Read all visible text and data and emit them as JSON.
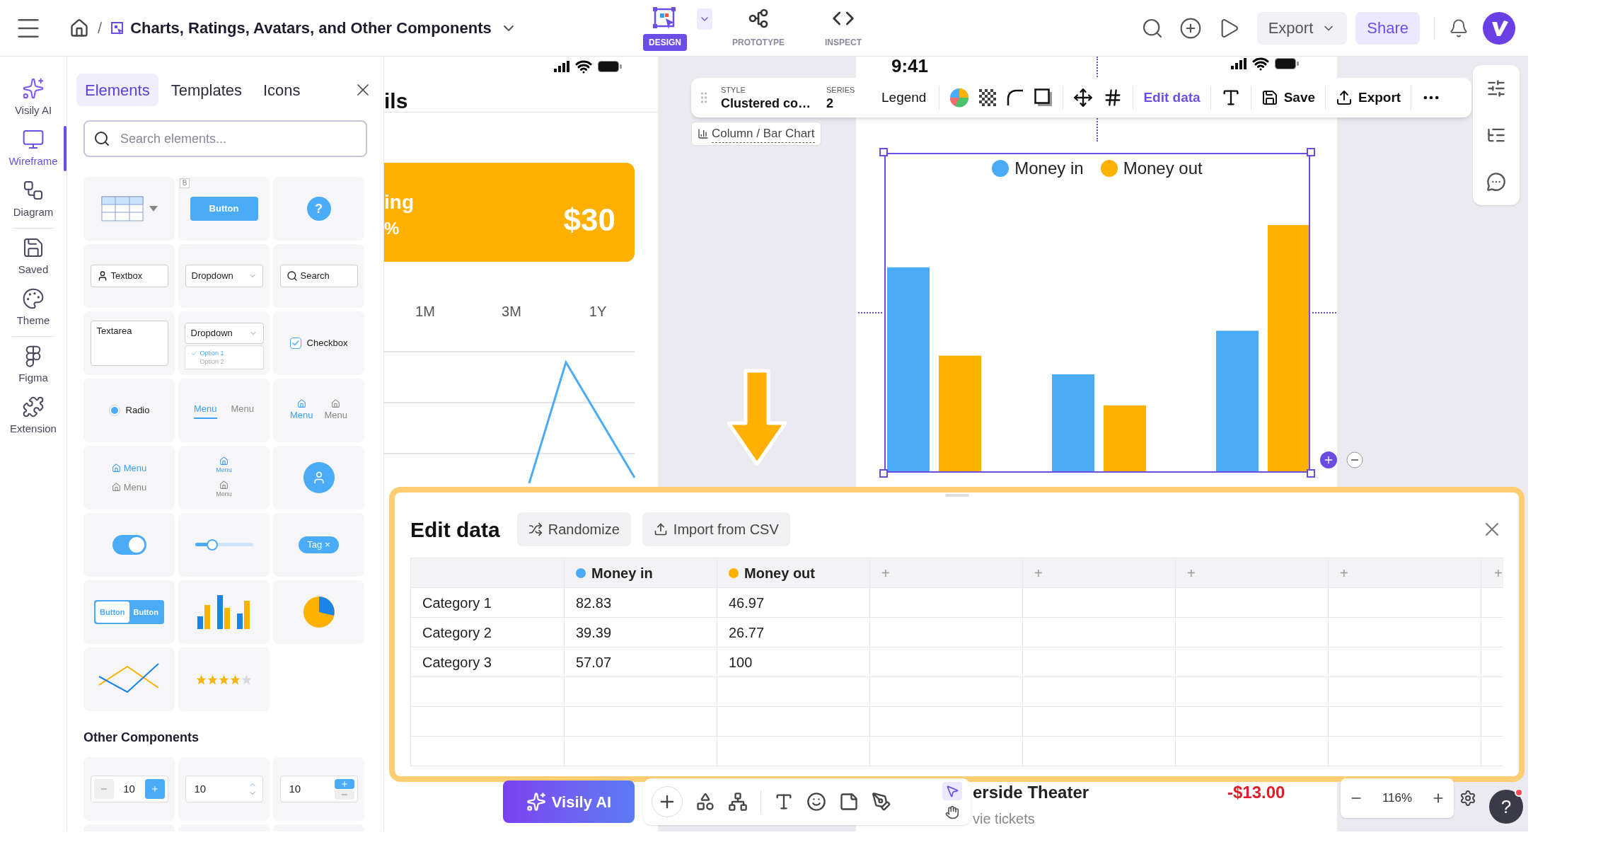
{
  "top_bar": {
    "separator": "/",
    "title": "Charts, Ratings, Avatars, and Other Components",
    "modes": [
      {
        "label": "DESIGN",
        "selected": true
      },
      {
        "label": "PROTOTYPE",
        "selected": false
      },
      {
        "label": "INSPECT",
        "selected": false
      }
    ],
    "export": "Export",
    "share": "Share"
  },
  "rail": [
    {
      "label": "Visily AI",
      "selected": false
    },
    {
      "label": "Wireframe",
      "selected": true
    },
    {
      "label": "Diagram",
      "selected": false
    },
    {
      "label": "Saved",
      "selected": false
    },
    {
      "label": "Theme",
      "selected": false
    },
    {
      "label": "Figma",
      "selected": false
    },
    {
      "label": "Extension",
      "selected": false
    }
  ],
  "panel": {
    "tabs": [
      {
        "label": "Elements",
        "selected": true
      },
      {
        "label": "Templates",
        "selected": false
      },
      {
        "label": "Icons",
        "selected": false
      }
    ],
    "search": {
      "placeholder": "Search elements..."
    },
    "tiles": [
      {
        "kind": "table"
      },
      {
        "kind": "button",
        "label": "Button",
        "badge": "B"
      },
      {
        "kind": "help",
        "label": "?"
      },
      {
        "kind": "textbox",
        "label": "Textbox"
      },
      {
        "kind": "dropdown",
        "label": "Dropdown"
      },
      {
        "kind": "search",
        "label": "Search"
      },
      {
        "kind": "textarea",
        "label": "Textarea"
      },
      {
        "kind": "dropdown_open",
        "label": "Dropdown",
        "options": [
          {
            "label": "Option 1",
            "selected": true
          },
          {
            "label": "Option 2",
            "selected": false
          }
        ]
      },
      {
        "kind": "checkbox",
        "label": "Checkbox",
        "checked": true
      },
      {
        "kind": "radio",
        "label": "Radio",
        "selected": true
      },
      {
        "kind": "menu_tabs",
        "items": [
          {
            "label": "Menu",
            "selected": true
          },
          {
            "label": "Menu",
            "selected": false
          }
        ]
      },
      {
        "kind": "menu_icons",
        "items": [
          {
            "label": "Menu",
            "selected": true
          },
          {
            "label": "Menu",
            "selected": false
          }
        ]
      },
      {
        "kind": "menu_list",
        "items": [
          {
            "label": "Menu",
            "selected": true
          },
          {
            "label": "Menu",
            "selected": false
          }
        ]
      },
      {
        "kind": "menu_stack",
        "items": [
          {
            "label": "Menu",
            "selected": true
          },
          {
            "label": "Menu",
            "selected": false
          }
        ]
      },
      {
        "kind": "avatar"
      },
      {
        "kind": "toggle",
        "on": true
      },
      {
        "kind": "slider",
        "level": 0.3
      },
      {
        "kind": "tag",
        "label": "Tag",
        "remove": "×"
      },
      {
        "kind": "segmented",
        "items": [
          {
            "label": "Button",
            "selected": true
          },
          {
            "label": "Button",
            "selected": false
          }
        ]
      },
      {
        "kind": "bars"
      },
      {
        "kind": "pie"
      },
      {
        "kind": "line"
      },
      {
        "kind": "stars",
        "stars": 4
      }
    ],
    "section_title": "Other Components",
    "other_tiles": [
      {
        "kind": "stepper",
        "value": "10"
      },
      {
        "kind": "spinner",
        "value": "10"
      },
      {
        "kind": "stacked_stepper",
        "value": "10"
      },
      {
        "kind": "empty"
      },
      {
        "kind": "empty"
      },
      {
        "kind": "empty"
      }
    ]
  },
  "left_frame": {
    "title": "ils",
    "card": {
      "line1": "ing",
      "line2": "%",
      "price": "$30"
    },
    "ranges": [
      "1M",
      "3M",
      "1Y"
    ]
  },
  "right_frame": {
    "time": "9:41",
    "legend": [
      {
        "label": "Money in",
        "color": "#4aabf9"
      },
      {
        "label": "Money out",
        "color": "#fdb100"
      }
    ],
    "footer": {
      "title": "erside Theater",
      "amount": "-$13.00",
      "subtitle": "vie tickets"
    }
  },
  "chart_toolbar": {
    "style_caption": "STYLE",
    "style": "Clustered co…",
    "series_caption": "SERIES",
    "series": "2",
    "legend": "Legend",
    "edit": "Edit data",
    "save": "Save",
    "export": "Export",
    "chart_type": "Column / Bar Chart"
  },
  "edit_data": {
    "title": "Edit data",
    "randomize": "Randomize",
    "import": "Import from CSV",
    "columns": [
      {
        "label": "Money in",
        "color": "#4aabf9"
      },
      {
        "label": "Money out",
        "color": "#fdb100"
      }
    ],
    "add_columns": [
      "+",
      "+",
      "+",
      "+",
      "+"
    ],
    "rows": [
      {
        "label": "Category 1",
        "values": [
          "82.83",
          "46.97"
        ]
      },
      {
        "label": "Category 2",
        "values": [
          "39.39",
          "26.77"
        ]
      },
      {
        "label": "Category 3",
        "values": [
          "57.07",
          "100"
        ]
      }
    ]
  },
  "bottom": {
    "ai_button": "Visily AI",
    "cursor_tools": [
      {
        "kind": "pointer",
        "selected": true
      },
      {
        "kind": "hand",
        "selected": false
      }
    ],
    "zoom": "116%",
    "help": "?"
  }
}
